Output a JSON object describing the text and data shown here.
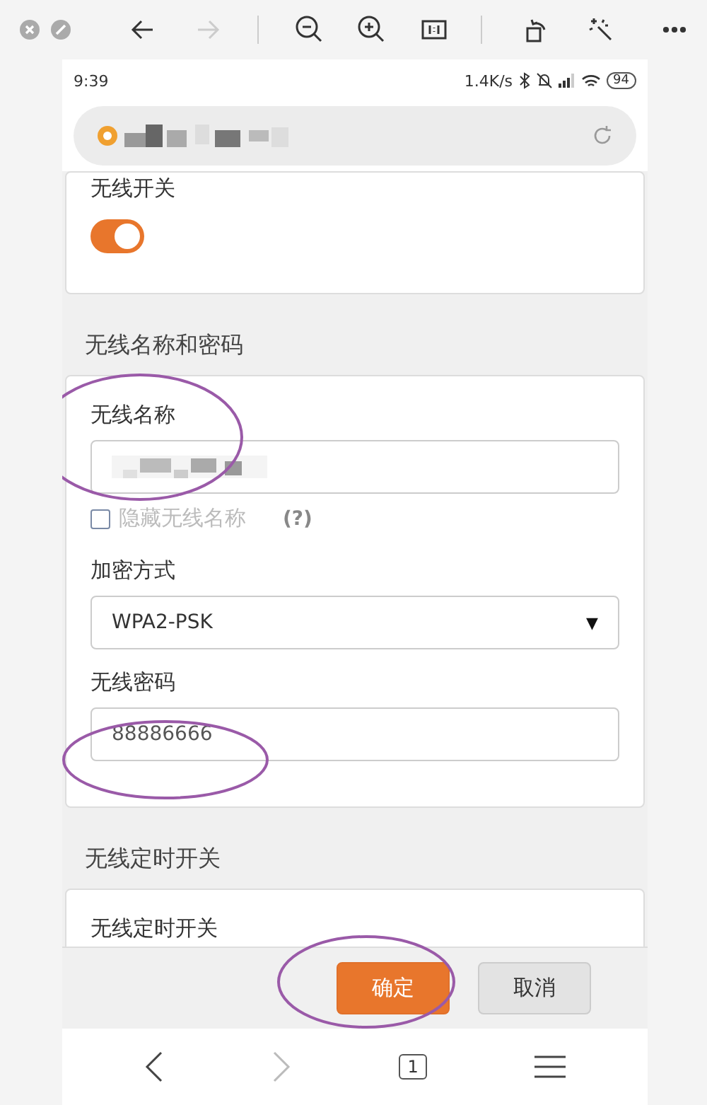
{
  "status_bar": {
    "time": "9:39",
    "speed": "1.4K/s",
    "battery": "94"
  },
  "sections": [
    {
      "fields": [
        {
          "kind": "toggle",
          "label": "无线开关",
          "on": true
        }
      ]
    },
    {
      "title": "无线名称和密码",
      "fields": [
        {
          "kind": "redacted_input",
          "label": "无线名称"
        },
        {
          "kind": "checkbox",
          "label": "隐藏无线名称",
          "checked": false,
          "help": "(?)"
        },
        {
          "kind": "select",
          "label": "加密方式",
          "value": "WPA2-PSK",
          "caret": "▼"
        },
        {
          "kind": "input",
          "label": "无线密码",
          "value": "88886666"
        }
      ]
    },
    {
      "title": "无线定时开关",
      "fields": [
        {
          "kind": "label",
          "label": "无线定时开关"
        }
      ]
    }
  ],
  "buttons": [
    {
      "label": "确定",
      "primary": true
    },
    {
      "label": "取消",
      "primary": false
    }
  ],
  "browser_nav": {
    "tab_count": "1"
  }
}
